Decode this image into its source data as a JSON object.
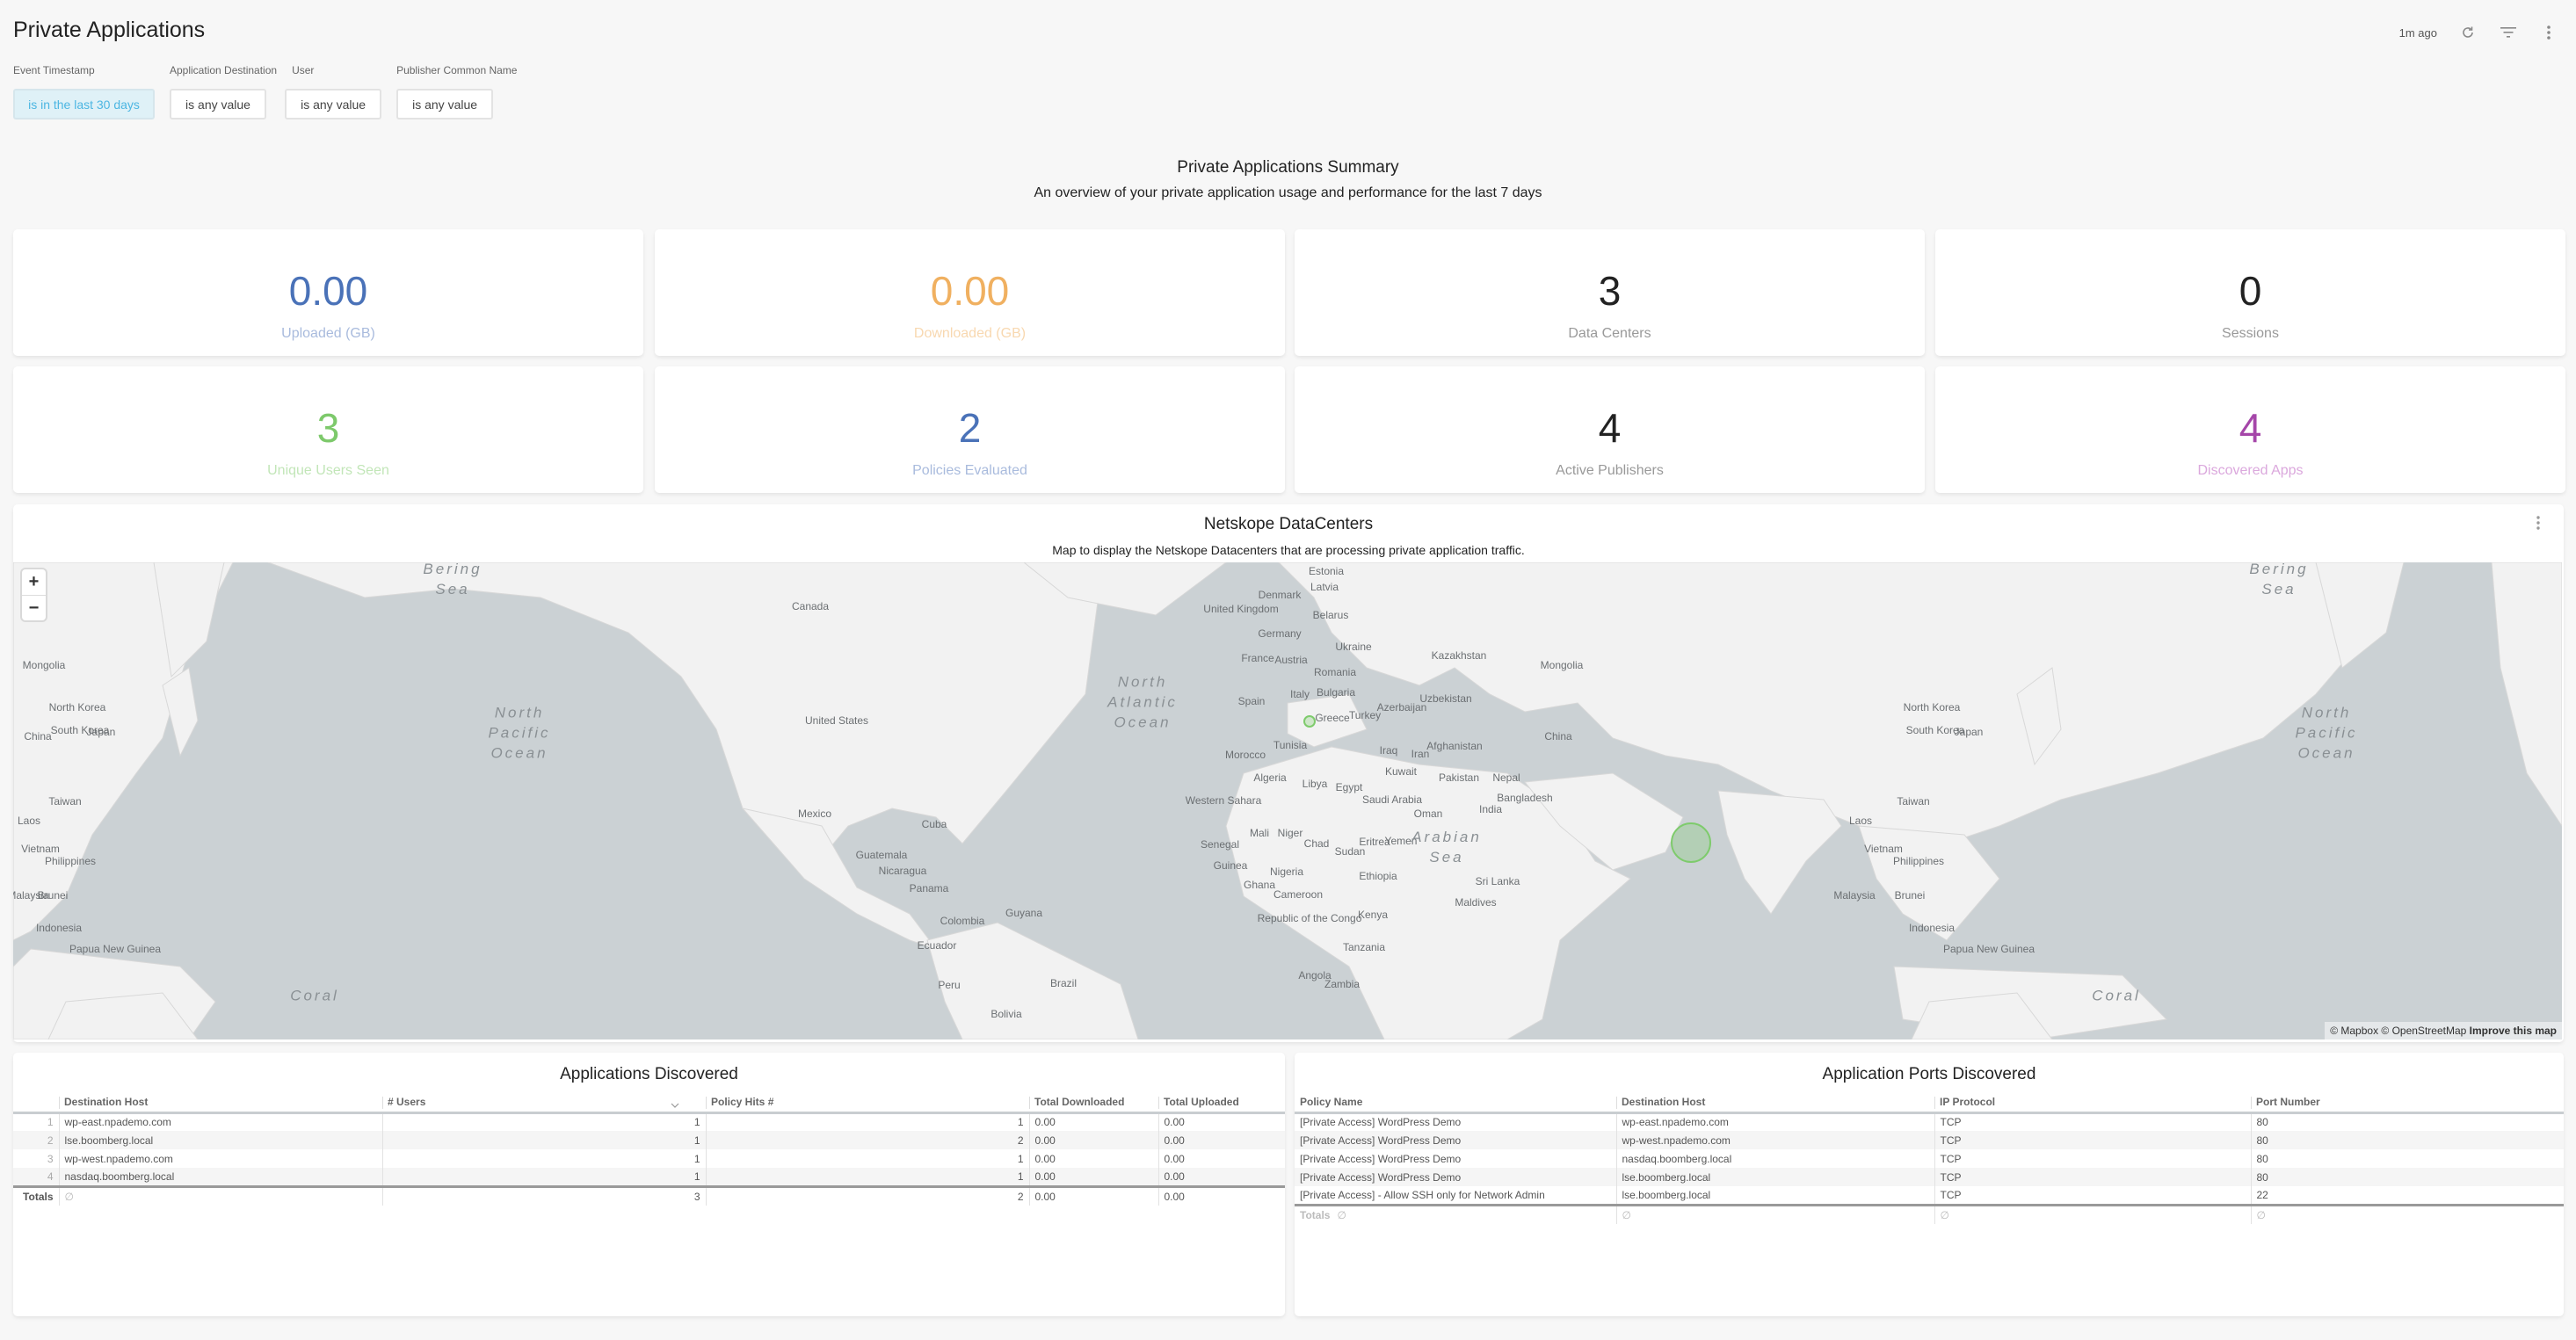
{
  "header": {
    "title": "Private Applications",
    "updated": "1m ago",
    "icons": [
      "refresh-icon",
      "filter-icon",
      "more-vertical-icon"
    ]
  },
  "filters": [
    {
      "label": "Event Timestamp",
      "value": "is in the last 30 days",
      "active": true
    },
    {
      "label": "Application Destination",
      "value": "is any value",
      "active": false
    },
    {
      "label": "User",
      "value": "is any value",
      "active": false
    },
    {
      "label": "Publisher Common Name",
      "value": "is any value",
      "active": false
    }
  ],
  "summary": {
    "title": "Private Applications Summary",
    "subtitle": "An overview of your private application usage and performance for the last 7 days"
  },
  "tiles": [
    {
      "value": "0.00",
      "label": "Uploaded (GB)",
      "color": "#4a72b8",
      "label_color": "#a9bbdd"
    },
    {
      "value": "0.00",
      "label": "Downloaded (GB)",
      "color": "#f0b060",
      "label_color": "#f8d8b0"
    },
    {
      "value": "3",
      "label": "Data Centers",
      "color": "#222222",
      "label_color": "#999999"
    },
    {
      "value": "0",
      "label": "Sessions",
      "color": "#222222",
      "label_color": "#999999"
    },
    {
      "value": "3",
      "label": "Unique Users Seen",
      "color": "#7dc96b",
      "label_color": "#c2e6b8"
    },
    {
      "value": "2",
      "label": "Policies Evaluated",
      "color": "#4a72b8",
      "label_color": "#a9bbdd"
    },
    {
      "value": "4",
      "label": "Active Publishers",
      "color": "#222222",
      "label_color": "#999999"
    },
    {
      "value": "4",
      "label": "Discovered Apps",
      "color": "#a546a9",
      "label_color": "#dba8dd"
    }
  ],
  "map_panel": {
    "title": "Netskope DataCenters",
    "subtitle": "Map to display the Netskope Datacenters that are processing private application traffic.",
    "zoom_in": "+",
    "zoom_out": "−",
    "attribution": "© Mapbox © OpenStreetMap",
    "improve": "Improve this map",
    "markers": [
      {
        "name": "Spain",
        "size": "small"
      },
      {
        "name": "India",
        "size": "large"
      }
    ],
    "labels": {
      "countries": [
        "Canada",
        "United States",
        "Mexico",
        "Cuba",
        "Guatemala",
        "Nicaragua",
        "Panama",
        "Colombia",
        "Ecuador",
        "Peru",
        "Brazil",
        "Bolivia",
        "Guyana",
        "United Kingdom",
        "Denmark",
        "Estonia",
        "Latvia",
        "Belarus",
        "Germany",
        "France",
        "Austria",
        "Ukraine",
        "Romania",
        "Bulgaria",
        "Italy",
        "Spain",
        "Greece",
        "Turkey",
        "Azerbaijan",
        "Kazakhstan",
        "Uzbekistan",
        "Mongolia",
        "China",
        "Afghanistan",
        "Iran",
        "Iraq",
        "Kuwait",
        "Pakistan",
        "Nepal",
        "India",
        "Bangladesh",
        "Sri Lanka",
        "Maldives",
        "Saudi Arabia",
        "Oman",
        "Yemen",
        "Eritrea",
        "Egypt",
        "Libya",
        "Tunisia",
        "Algeria",
        "Morocco",
        "Western Sahara",
        "Mali",
        "Niger",
        "Chad",
        "Sudan",
        "Ethiopia",
        "Senegal",
        "Guinea",
        "Ghana",
        "Nigeria",
        "Cameroon",
        "Republic of the Congo",
        "Kenya",
        "Tanzania",
        "Angola",
        "Zambia",
        "Laos",
        "Vietnam",
        "Malaysia",
        "Brunei",
        "Indonesia",
        "Philippines",
        "Taiwan",
        "North Korea",
        "South Korea",
        "Japan",
        "Papua New Guinea"
      ],
      "oceans": [
        "Bering Sea",
        "North Pacific Ocean",
        "North Atlantic Ocean",
        "Arabian Sea",
        "Coral"
      ]
    }
  },
  "apps_table": {
    "title": "Applications Discovered",
    "columns": [
      "Destination Host",
      "# Users",
      "Policy Hits #",
      "Total Downloaded",
      "Total Uploaded"
    ],
    "rows": [
      {
        "idx": "1",
        "host": "wp-east.npademo.com",
        "users": "1",
        "hits": "1",
        "down": "0.00",
        "up": "0.00"
      },
      {
        "idx": "2",
        "host": "lse.boomberg.local",
        "users": "1",
        "hits": "2",
        "down": "0.00",
        "up": "0.00"
      },
      {
        "idx": "3",
        "host": "wp-west.npademo.com",
        "users": "1",
        "hits": "1",
        "down": "0.00",
        "up": "0.00"
      },
      {
        "idx": "4",
        "host": "nasdaq.boomberg.local",
        "users": "1",
        "hits": "1",
        "down": "0.00",
        "up": "0.00"
      }
    ],
    "totals": {
      "label": "Totals",
      "host": "∅",
      "users": "3",
      "hits": "2",
      "down": "0.00",
      "up": "0.00"
    }
  },
  "ports_table": {
    "title": "Application Ports Discovered",
    "columns": [
      "Policy Name",
      "Destination Host",
      "IP Protocol",
      "Port Number"
    ],
    "rows": [
      {
        "policy": "[Private Access] WordPress Demo",
        "host": "wp-east.npademo.com",
        "proto": "TCP",
        "port": "80"
      },
      {
        "policy": "[Private Access] WordPress Demo",
        "host": "wp-west.npademo.com",
        "proto": "TCP",
        "port": "80"
      },
      {
        "policy": "[Private Access] WordPress Demo",
        "host": "nasdaq.boomberg.local",
        "proto": "TCP",
        "port": "80"
      },
      {
        "policy": "[Private Access] WordPress Demo",
        "host": "lse.boomberg.local",
        "proto": "TCP",
        "port": "80"
      },
      {
        "policy": "[Private Access] - Allow SSH only for Network Admin",
        "host": "lse.boomberg.local",
        "proto": "TCP",
        "port": "22"
      }
    ],
    "totals": {
      "label": "Totals",
      "policy": "∅",
      "host": "∅",
      "proto": "∅",
      "port": "∅"
    }
  }
}
